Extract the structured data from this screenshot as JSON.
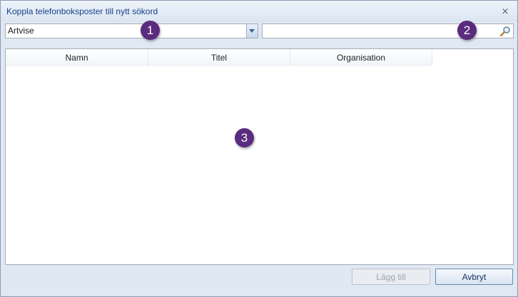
{
  "window": {
    "title": "Koppla telefonboksposter till nytt sökord"
  },
  "filter_combo": {
    "value": "Artvise"
  },
  "search": {
    "value": "",
    "placeholder": ""
  },
  "grid": {
    "columns": [
      "Namn",
      "Titel",
      "Organisation"
    ],
    "rows": []
  },
  "buttons": {
    "add": "Lägg till",
    "cancel": "Avbryt"
  },
  "callouts": {
    "c1": "1",
    "c2": "2",
    "c3": "3"
  },
  "colors": {
    "callout": "#5a2b7e",
    "title_text": "#15428b",
    "window_bg": "#dfe8f3"
  }
}
